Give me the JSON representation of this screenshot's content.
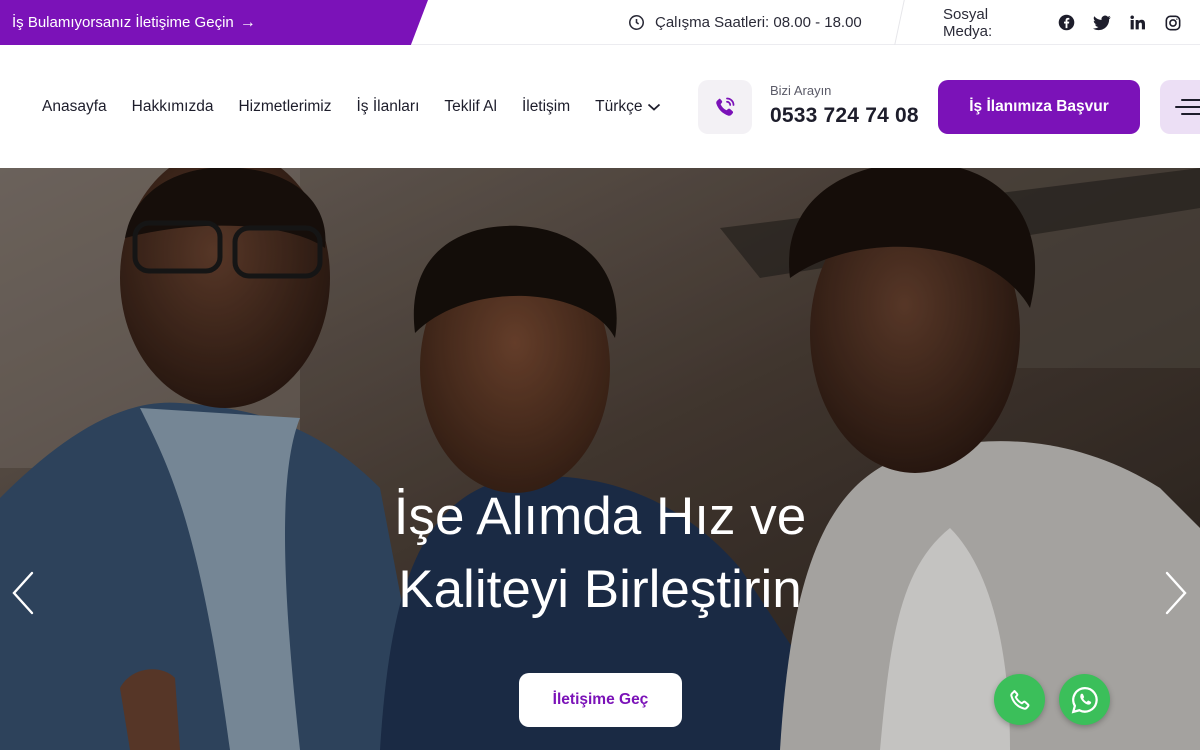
{
  "topbar": {
    "promo_text": "İş Bulamıyorsanız İletişime Geçin",
    "promo_arrow": "→",
    "hours_text": "Çalışma Saatleri: 08.00 - 18.00",
    "social_label": "Sosyal Medya:",
    "social_icons": [
      "facebook-icon",
      "twitter-icon",
      "linkedin-icon",
      "instagram-icon"
    ],
    "promo_color": "#7b12b8"
  },
  "header": {
    "nav": [
      "Anasayfa",
      "Hakkımızda",
      "Hizmetlerimiz",
      "İş İlanları",
      "Teklif Al",
      "İletişim"
    ],
    "language": "Türkçe",
    "call_label": "Bizi Arayın",
    "call_number": "0533 724 74 08",
    "apply_label": "İş İlanımıza Başvur",
    "accent": "#7b12b8"
  },
  "hero": {
    "title_line1": "İşe Alımda Hız ve",
    "title_line2": "Kaliteyi Birleştirin",
    "cta_label": "İletişime Geç",
    "float_color": "#3bbf5a"
  }
}
